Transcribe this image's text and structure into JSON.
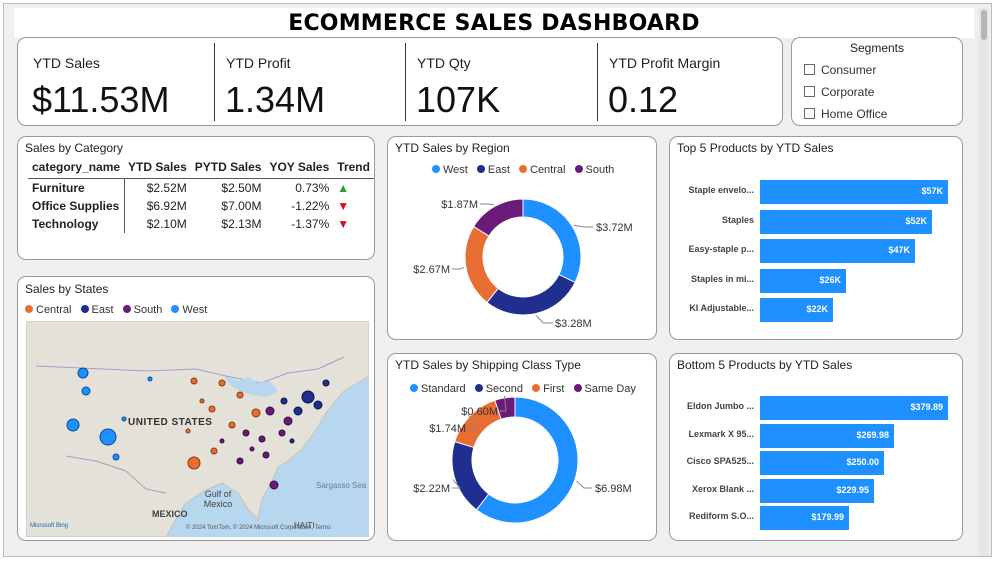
{
  "title": "ECOMMERCE SALES DASHBOARD",
  "colors": {
    "blue": "#1e90ff",
    "navy": "#1f2e8f",
    "orange": "#e86d32",
    "purple": "#6a1b7a",
    "up": "#2ca02c",
    "down": "#d0102a"
  },
  "kpis": [
    {
      "label": "YTD Sales",
      "value": "$11.53M"
    },
    {
      "label": "YTD Profit",
      "value": "1.34M"
    },
    {
      "label": "YTD Qty",
      "value": "107K"
    },
    {
      "label": "YTD Profit Margin",
      "value": "0.12"
    }
  ],
  "segments": {
    "title": "Segments",
    "items": [
      "Consumer",
      "Corporate",
      "Home Office"
    ]
  },
  "category_table": {
    "title": "Sales by Category",
    "headers": [
      "category_name",
      "YTD Sales",
      "PYTD Sales",
      "YOY Sales",
      "Trend"
    ],
    "rows": [
      {
        "name": "Furniture",
        "ytd": "$2.52M",
        "pytd": "$2.50M",
        "yoy": "0.73%",
        "trend": "▲",
        "trend_dir": "up"
      },
      {
        "name": "Office Supplies",
        "ytd": "$6.92M",
        "pytd": "$7.00M",
        "yoy": "-1.22%",
        "trend": "▼",
        "trend_dir": "down"
      },
      {
        "name": "Technology",
        "ytd": "$2.10M",
        "pytd": "$2.13M",
        "yoy": "-1.37%",
        "trend": "▼",
        "trend_dir": "down"
      }
    ]
  },
  "states": {
    "title": "Sales by States",
    "legend": [
      "Central",
      "East",
      "South",
      "West"
    ],
    "map_labels": {
      "country": "UNITED STATES",
      "gulf": "Gulf of Mexico",
      "mexico": "MEXICO",
      "haiti": "HAITI",
      "sargasso": "Sargasso Sea",
      "attribution": "Microsoft Bing",
      "copyright": "© 2024 TomTom, © 2024 Microsoft Corporation, Terms"
    }
  },
  "region": {
    "title": "YTD Sales by Region",
    "legend": [
      "West",
      "East",
      "Central",
      "South"
    ]
  },
  "shipping": {
    "title": "YTD Sales by Shipping Class Type",
    "legend": [
      "Standard",
      "Second",
      "First",
      "Same Day"
    ]
  },
  "top5": {
    "title": "Top 5 Products by YTD Sales",
    "items": [
      {
        "name": "Staple envelo...",
        "value_label": "$57K"
      },
      {
        "name": "Staples",
        "value_label": "$52K"
      },
      {
        "name": "Easy-staple p...",
        "value_label": "$47K"
      },
      {
        "name": "Staples in mi...",
        "value_label": "$26K"
      },
      {
        "name": "KI Adjustable...",
        "value_label": "$22K"
      }
    ]
  },
  "bottom5": {
    "title": "Bottom 5 Products by YTD Sales",
    "items": [
      {
        "name": "Eldon Jumbo ...",
        "value_label": "$379.89"
      },
      {
        "name": "Lexmark X 95...",
        "value_label": "$269.98"
      },
      {
        "name": "Cisco SPA525...",
        "value_label": "$250.00"
      },
      {
        "name": "Xerox Blank ...",
        "value_label": "$229.95"
      },
      {
        "name": "Rediform S.O...",
        "value_label": "$179.99"
      }
    ]
  },
  "chart_data": [
    {
      "type": "pie",
      "title": "YTD Sales by Region",
      "categories": [
        "West",
        "East",
        "Central",
        "South"
      ],
      "values": [
        3.72,
        3.28,
        2.67,
        1.87
      ],
      "labels": [
        "$3.72M",
        "$3.28M",
        "$2.67M",
        "$1.87M"
      ],
      "legend": "top"
    },
    {
      "type": "pie",
      "title": "YTD Sales by Shipping Class Type",
      "categories": [
        "Standard",
        "Second",
        "First",
        "Same Day"
      ],
      "values": [
        6.98,
        2.22,
        1.74,
        0.6
      ],
      "labels": [
        "$6.98M",
        "$2.22M",
        "$1.74M",
        "$0.60M"
      ],
      "legend": "top"
    },
    {
      "type": "bar",
      "title": "Top 5 Products by YTD Sales",
      "categories": [
        "Staple envelo...",
        "Staples",
        "Easy-staple p...",
        "Staples in mi...",
        "KI Adjustable..."
      ],
      "values": [
        57,
        52,
        47,
        26,
        22
      ],
      "ylabel": "",
      "ylim": [
        0,
        57
      ]
    },
    {
      "type": "bar",
      "title": "Bottom 5 Products by YTD Sales",
      "categories": [
        "Eldon Jumbo ...",
        "Lexmark X 95...",
        "Cisco SPA525...",
        "Xerox Blank ...",
        "Rediform S.O..."
      ],
      "values": [
        379.89,
        269.98,
        250.0,
        229.95,
        179.99
      ],
      "ylim": [
        0,
        379.89
      ]
    }
  ]
}
